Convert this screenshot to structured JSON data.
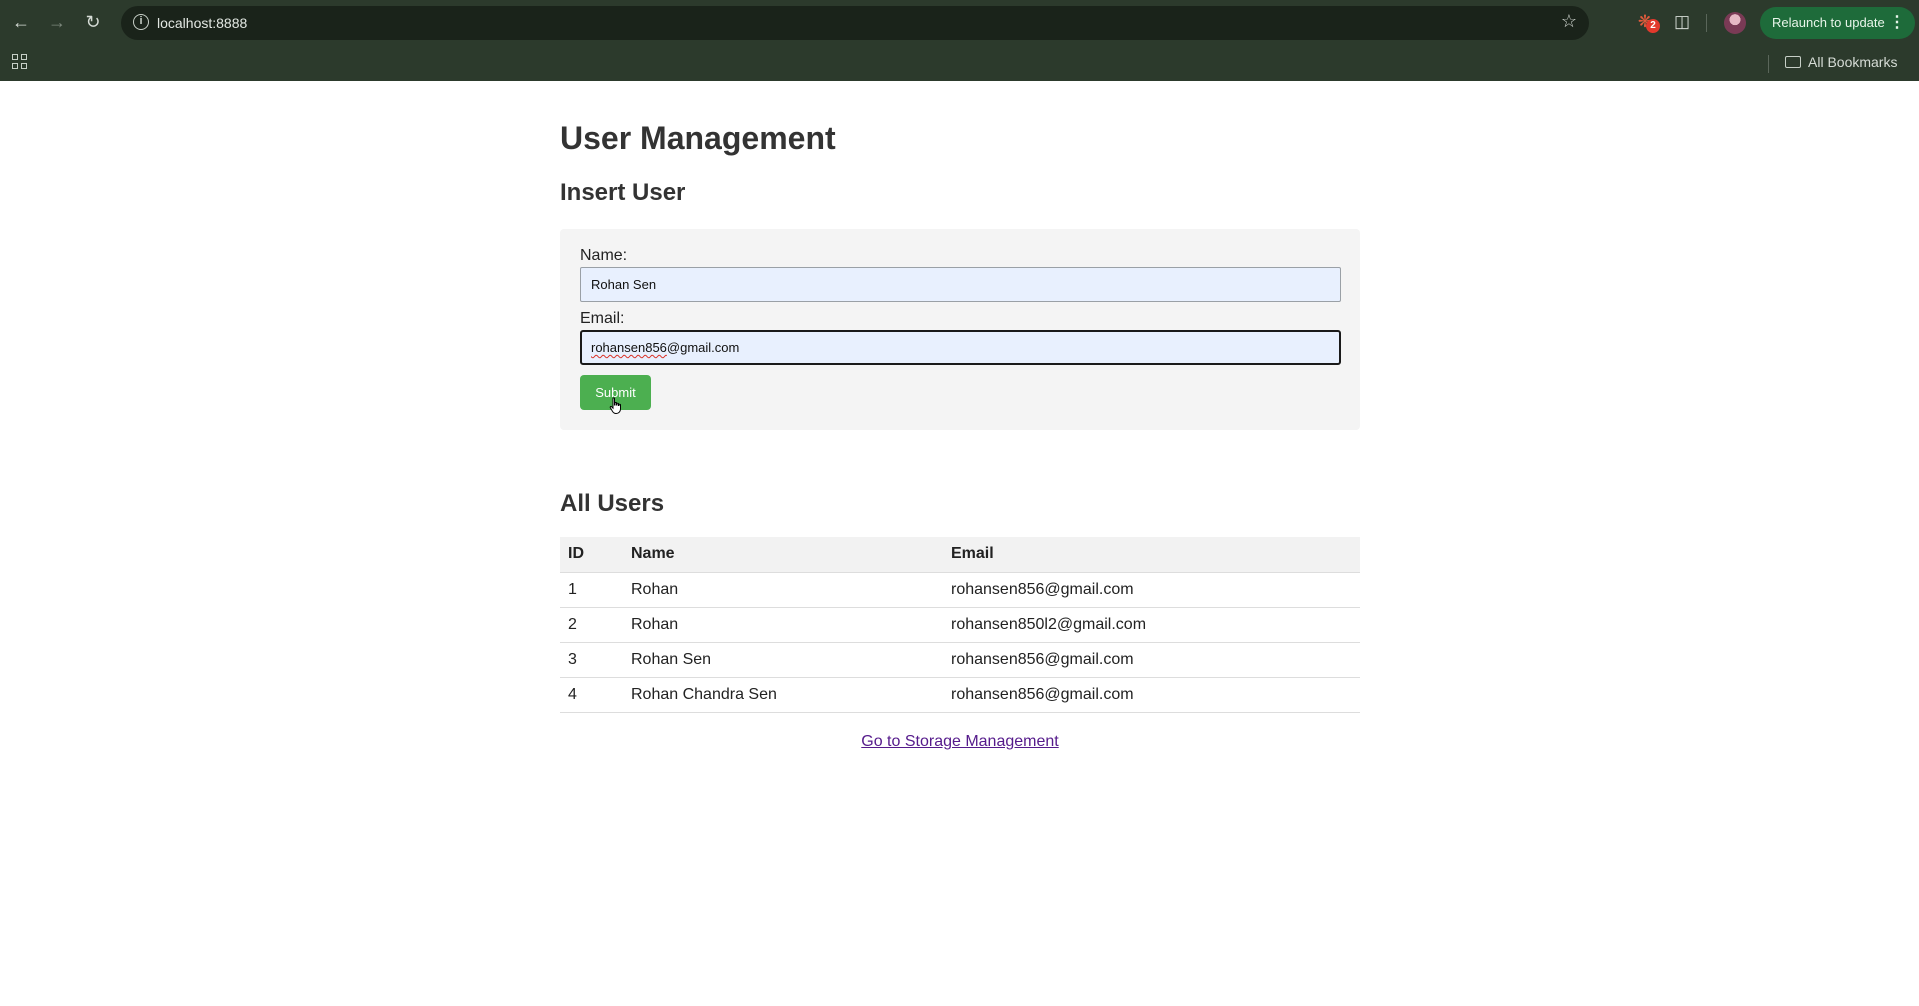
{
  "browser": {
    "url": "localhost:8888",
    "extensions_badge": "2",
    "relaunch_label": "Relaunch to update",
    "bookmarks_label": "All Bookmarks"
  },
  "page": {
    "title": "User Management",
    "insert_heading": "Insert User",
    "form": {
      "name_label": "Name:",
      "name_value": "Rohan Sen",
      "email_label": "Email:",
      "email_value_misspelled": "rohansen856",
      "email_value_rest": "@gmail.com",
      "submit_label": "Submit"
    },
    "users_heading": "All Users",
    "table": {
      "headers": [
        "ID",
        "Name",
        "Email"
      ],
      "rows": [
        [
          "1",
          "Rohan",
          "rohansen856@gmail.com"
        ],
        [
          "2",
          "Rohan",
          "rohansen850l2@gmail.com"
        ],
        [
          "3",
          "Rohan Sen",
          "rohansen856@gmail.com"
        ],
        [
          "4",
          "Rohan Chandra Sen",
          "rohansen856@gmail.com"
        ]
      ]
    },
    "storage_link": "Go to Storage Management"
  }
}
